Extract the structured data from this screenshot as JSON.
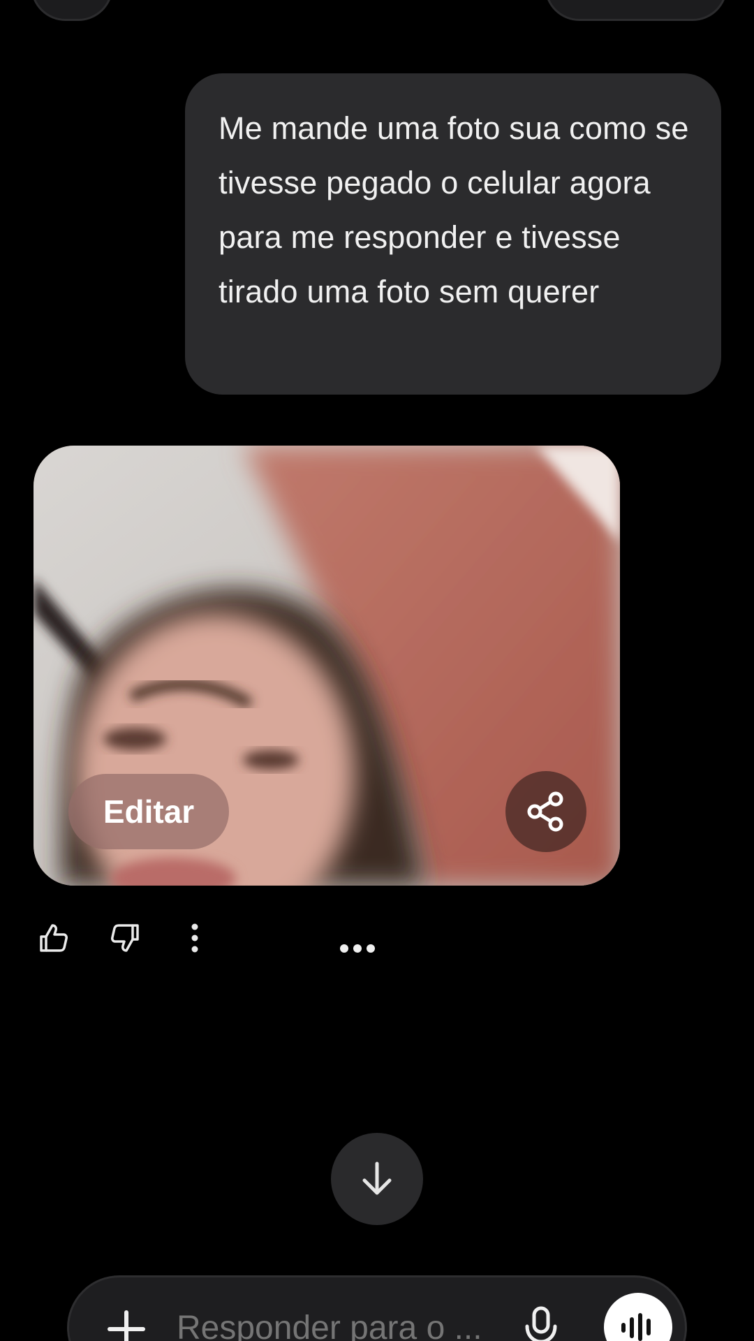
{
  "conversation": {
    "user_message": "Me mande uma foto sua como se tivesse pegado o celular agora para me responder e tivesse tirado uma foto sem querer",
    "image_card": {
      "edit_label": "Editar",
      "share_icon": "share-icon"
    },
    "feedback": {
      "like_icon": "thumbs-up-icon",
      "dislike_icon": "thumbs-down-icon",
      "more_icon": "more-vertical-icon",
      "typing_indicator": "typing-dots"
    }
  },
  "scroll_down": {
    "icon": "arrow-down-icon"
  },
  "composer": {
    "add_icon": "plus-icon",
    "placeholder": "Responder para o ...",
    "mic_icon": "microphone-icon",
    "voice_icon": "voice-waveform-icon"
  },
  "colors": {
    "background": "#000000",
    "bubble": "#2b2b2d",
    "composer": "#1e1e20",
    "text": "#f1f1f1",
    "placeholder": "#8d8d90"
  }
}
